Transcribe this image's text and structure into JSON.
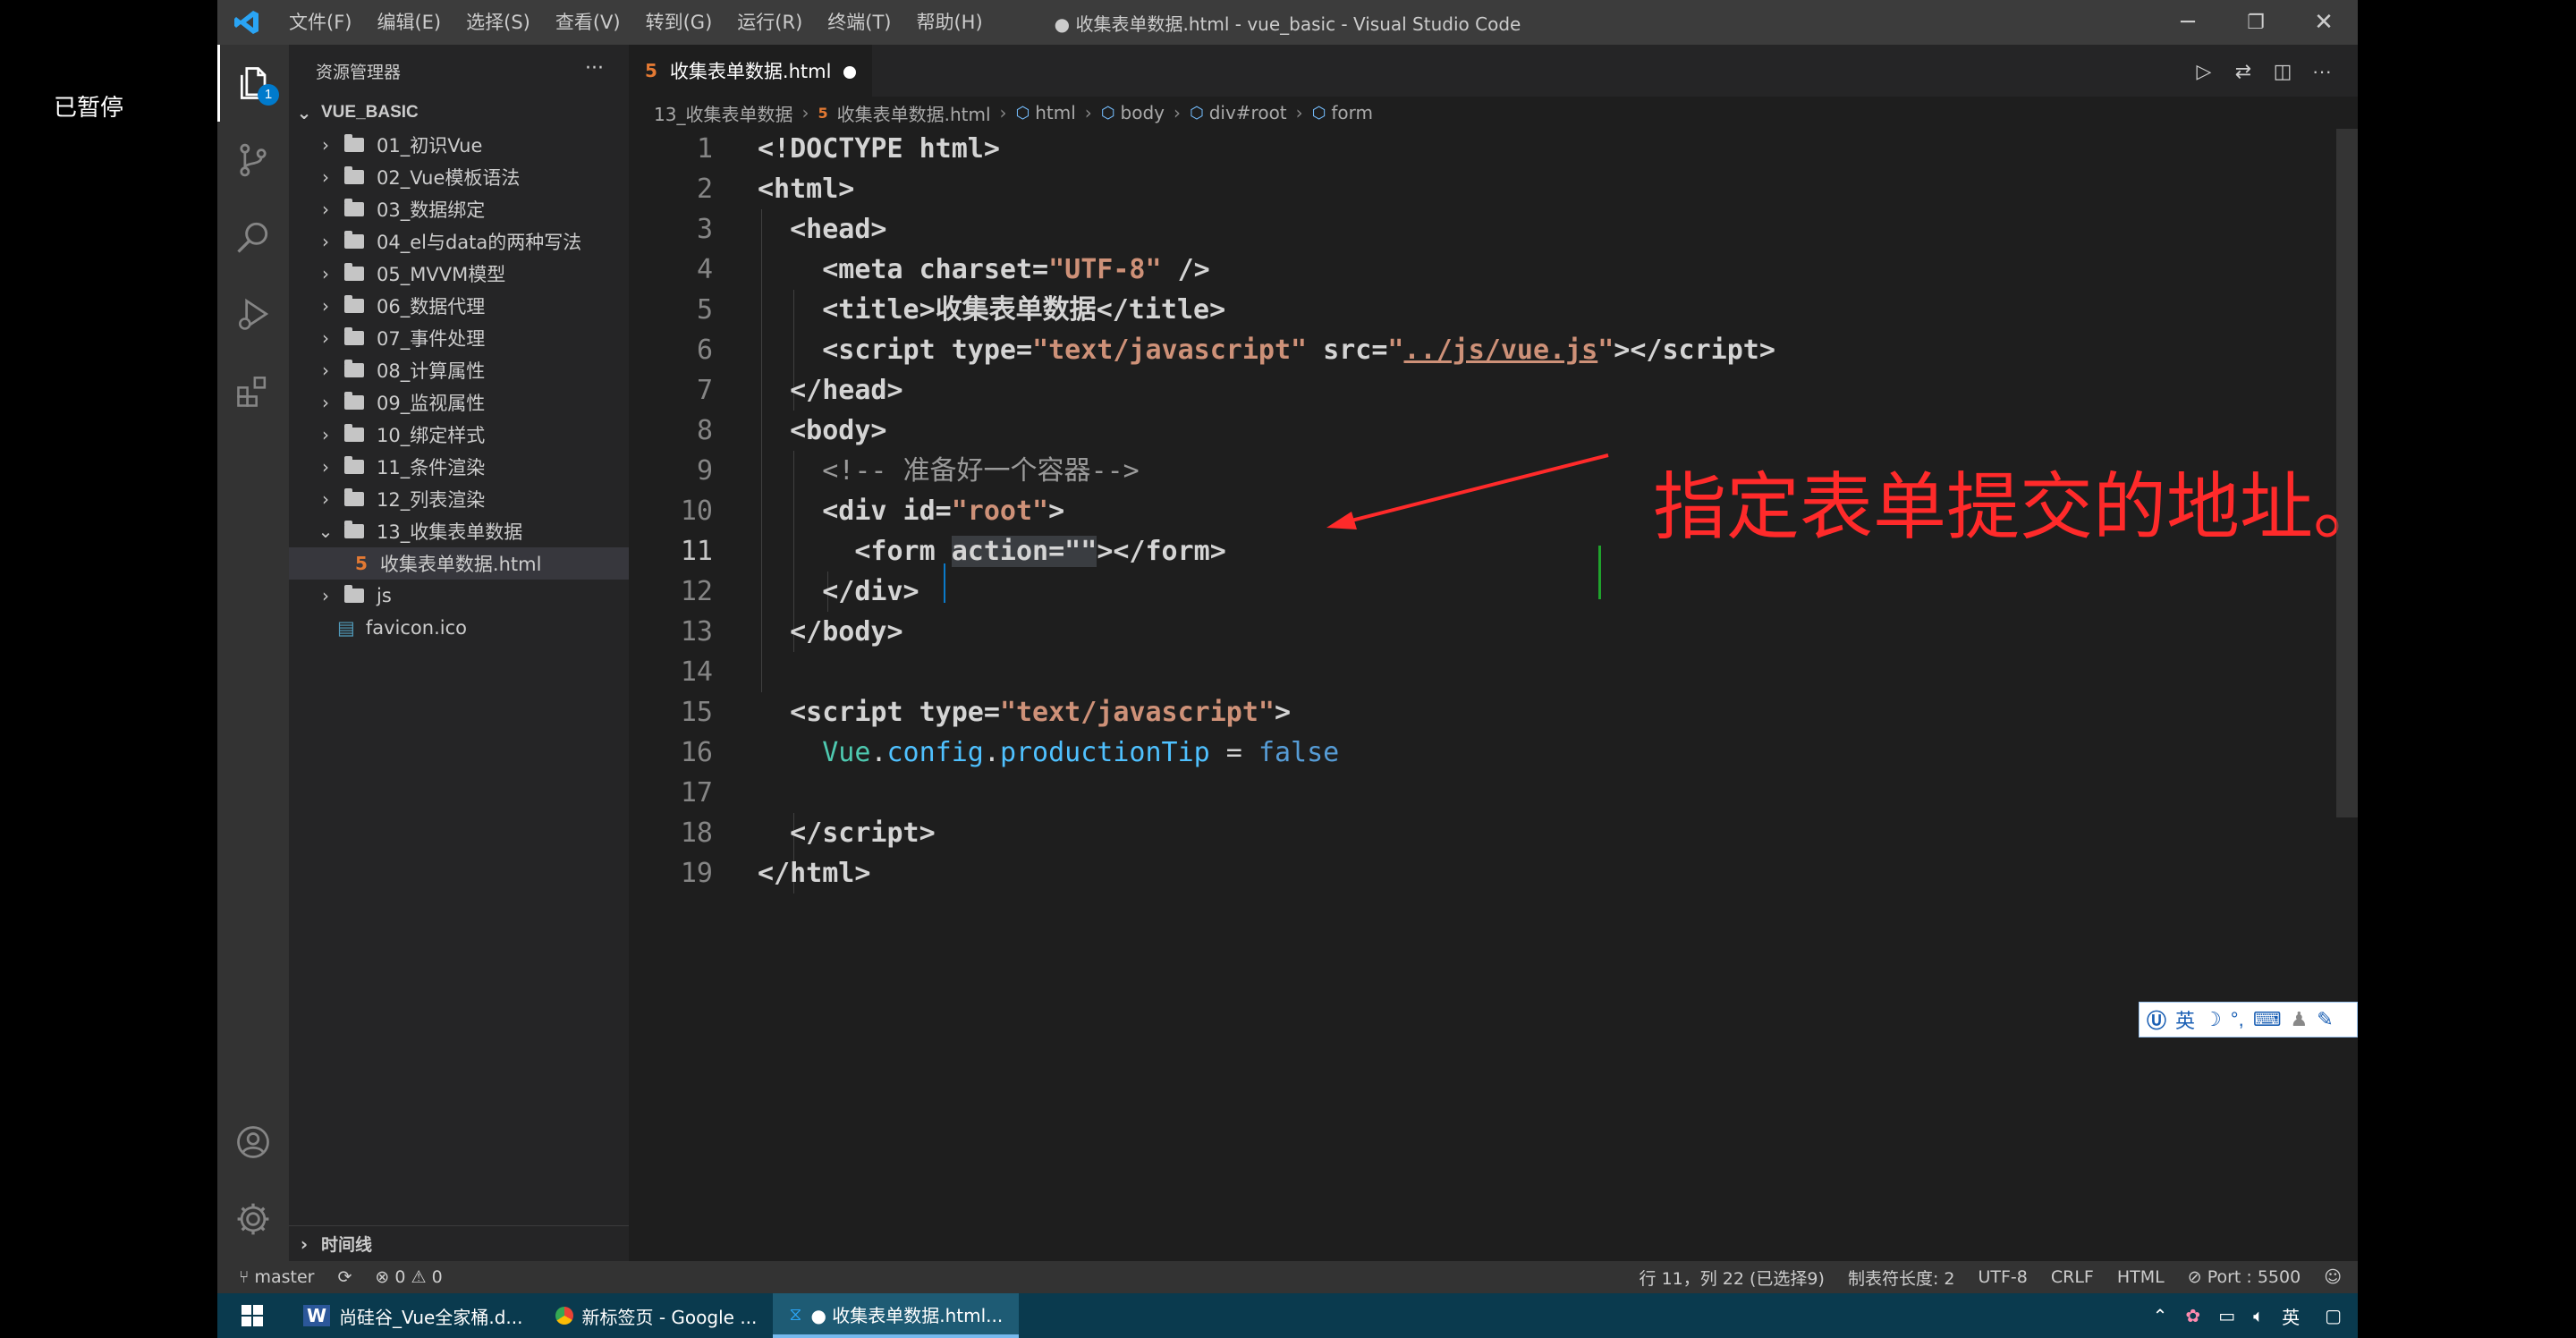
{
  "overlay_label": "已暂停",
  "titlebar": {
    "menu": [
      "文件(F)",
      "编辑(E)",
      "选择(S)",
      "查看(V)",
      "转到(G)",
      "运行(R)",
      "终端(T)",
      "帮助(H)"
    ],
    "title": "● 收集表单数据.html - vue_basic - Visual Studio Code",
    "minimize": "─",
    "restore": "❐",
    "close": "✕"
  },
  "activity": {
    "explorer_badge": "1",
    "icons": [
      "files-icon",
      "source-control-icon",
      "search-icon",
      "run-debug-icon",
      "extensions-icon",
      "account-icon",
      "settings-gear-icon"
    ]
  },
  "sidebar": {
    "header": "资源管理器",
    "more": "···",
    "project": "VUE_BASIC",
    "items": [
      {
        "label": "01_初识Vue",
        "kind": "folder",
        "open": false
      },
      {
        "label": "02_Vue模板语法",
        "kind": "folder",
        "open": false
      },
      {
        "label": "03_数据绑定",
        "kind": "folder",
        "open": false
      },
      {
        "label": "04_el与data的两种写法",
        "kind": "folder",
        "open": false
      },
      {
        "label": "05_MVVM模型",
        "kind": "folder",
        "open": false
      },
      {
        "label": "06_数据代理",
        "kind": "folder",
        "open": false
      },
      {
        "label": "07_事件处理",
        "kind": "folder",
        "open": false
      },
      {
        "label": "08_计算属性",
        "kind": "folder",
        "open": false
      },
      {
        "label": "09_监视属性",
        "kind": "folder",
        "open": false
      },
      {
        "label": "10_绑定样式",
        "kind": "folder",
        "open": false
      },
      {
        "label": "11_条件渲染",
        "kind": "folder",
        "open": false
      },
      {
        "label": "12_列表渲染",
        "kind": "folder",
        "open": false
      },
      {
        "label": "13_收集表单数据",
        "kind": "folder",
        "open": true
      },
      {
        "label": "收集表单数据.html",
        "kind": "html",
        "open": false
      },
      {
        "label": "js",
        "kind": "folder",
        "open": false
      },
      {
        "label": "favicon.ico",
        "kind": "file",
        "open": false
      }
    ],
    "timeline": "时间线"
  },
  "tab": {
    "label": "收集表单数据.html"
  },
  "breadcrumb": [
    "13_收集表单数据",
    "收集表单数据.html",
    "html",
    "body",
    "div#root",
    "form"
  ],
  "code": {
    "lines": [
      "1",
      "2",
      "3",
      "4",
      "5",
      "6",
      "7",
      "8",
      "9",
      "10",
      "11",
      "12",
      "13",
      "14",
      "15",
      "16",
      "17",
      "18",
      "19"
    ],
    "current_line": "11"
  },
  "annotation": "指定表单提交的地址。",
  "ime": {
    "label": "英"
  },
  "statusbar": {
    "branch": "master",
    "errors": "0",
    "warnings": "0",
    "position": "行 11，列 22 (已选择9)",
    "tab_size": "制表符长度: 2",
    "encoding": "UTF-8",
    "eol": "CRLF",
    "language": "HTML",
    "port": "Port : 5500"
  },
  "taskbar": {
    "items": [
      "尚硅谷_Vue全家桶.d...",
      "新标签页 - Google ...",
      "● 收集表单数据.html..."
    ],
    "ime": "英"
  },
  "colors": {
    "accent": "#007acc",
    "annotation": "#ff2a2a",
    "titlebar": "#3c3c3c",
    "sidebar": "#252526",
    "editor": "#1e1e1e"
  }
}
